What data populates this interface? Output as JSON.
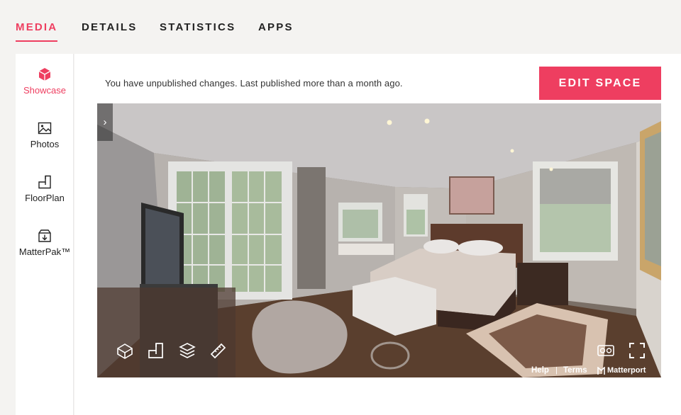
{
  "tabs": [
    {
      "label": "MEDIA",
      "active": true
    },
    {
      "label": "DETAILS",
      "active": false
    },
    {
      "label": "STATISTICS",
      "active": false
    },
    {
      "label": "APPS",
      "active": false
    }
  ],
  "sidebar": {
    "items": [
      {
        "label": "Showcase",
        "icon": "cube-icon",
        "active": true
      },
      {
        "label": "Photos",
        "icon": "image-icon",
        "active": false
      },
      {
        "label": "FloorPlan",
        "icon": "floorplan-icon",
        "active": false
      },
      {
        "label": "MatterPak™",
        "icon": "matterpak-download-icon",
        "active": false
      }
    ]
  },
  "main": {
    "notice": "You have unpublished changes.  Last published more than a month ago.",
    "edit_button": "EDIT SPACE"
  },
  "viewer": {
    "expand_icon": "chevron-right-icon",
    "toolbar": [
      {
        "icon": "dollhouse-icon"
      },
      {
        "icon": "floorplan-view-icon"
      },
      {
        "icon": "floors-icon"
      },
      {
        "icon": "measure-icon"
      }
    ],
    "vr_icon": "vr-headset-icon",
    "fullscreen_icon": "fullscreen-icon",
    "footer": {
      "help": "Help",
      "separator": "|",
      "terms": "Terms",
      "brand": "Matterport"
    }
  },
  "colors": {
    "accent": "#ee3e60",
    "background": "#f4f3f1",
    "panel": "#ffffff"
  }
}
